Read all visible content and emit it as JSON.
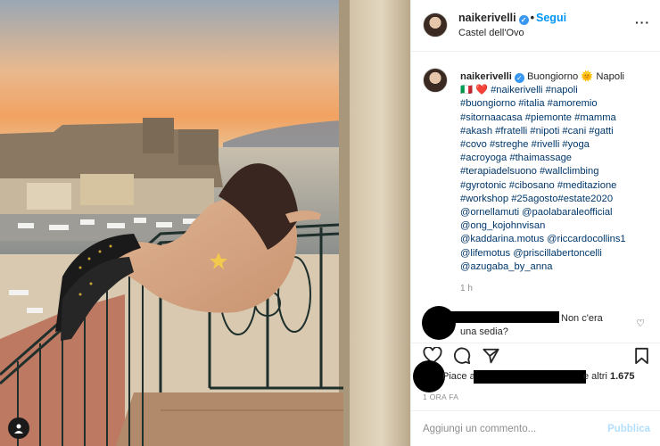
{
  "post": {
    "username": "naikerivelli",
    "verified_icon": "verified-badge-icon",
    "follow_label": "Segui",
    "location": "Castel dell'Ovo",
    "more_icon": "more-options-icon"
  },
  "caption": {
    "username": "naikerivelli",
    "text_lines": [
      "Buongiorno 🌞 Napoli",
      "🇮🇹 ❤️ #naikerivelli #napoli",
      "#buongiorno #italia #amoremio",
      "#sitornaacasa #piemonte #mamma",
      "#akash #fratelli #nipoti #cani #gatti",
      "#covo #streghe #rivelli #yoga",
      "#acroyoga #thaimassage",
      "#terapiadelsuono #wallclimbing",
      "#gyrotonic #cibosano #meditazione",
      "#workshop #25agosto#estate2020",
      "@ornellamuti @paolabaraleofficial",
      "@ong_kojohnvisan",
      "@kaddarina.motus @riccardocollins1",
      "@lifemotus @priscillabertoncelli",
      "@azugaba_by_anna"
    ],
    "time": "1 h"
  },
  "comment": {
    "text_right": "Non c'era",
    "text_wrap": "una sedia?"
  },
  "likes": {
    "prefix": "Piace a",
    "suffix": "e altri",
    "count": "1.675"
  },
  "post_time": "1 ORA FA",
  "comment_box": {
    "placeholder": "Aggiungi un commento...",
    "publish_label": "Pubblica"
  },
  "colors": {
    "accent": "#0095f6",
    "link": "#00376b",
    "muted": "#8e8e8e",
    "publish_disabled": "#b2dffc"
  }
}
